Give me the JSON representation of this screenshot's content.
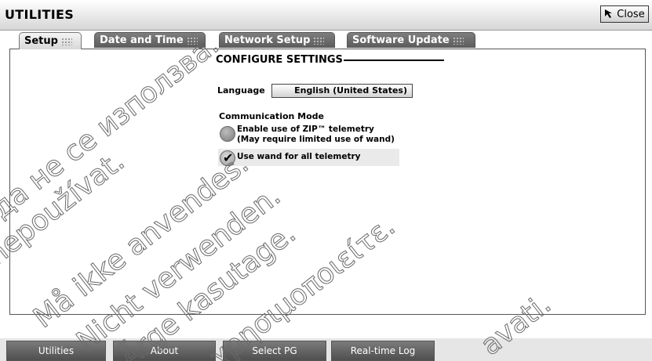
{
  "window": {
    "title": "UTILITIES",
    "close_label": "Close"
  },
  "tabs": [
    {
      "label": "Setup",
      "active": true
    },
    {
      "label": "Date and Time",
      "active": false
    },
    {
      "label": "Network Setup",
      "active": false
    },
    {
      "label": "Software Update",
      "active": false
    }
  ],
  "setup": {
    "heading": "CONFIGURE SETTINGS",
    "language_label": "Language",
    "language_value": "English (United States)",
    "comm_mode_label": "Communication Mode",
    "options": [
      {
        "line1": "Enable use of ZIP™ telemetry",
        "line2": "(May require limited use of wand)",
        "selected": false
      },
      {
        "line1": "Use wand for all telemetry",
        "selected": true
      }
    ]
  },
  "bottom_nav": [
    {
      "label": "Utilities"
    },
    {
      "label": "About"
    },
    {
      "label": "Select PG"
    },
    {
      "label": "Real-time Log"
    }
  ],
  "watermark": [
    "да не се използва.",
    "nepoužívat.",
    "Må ikke anvendes.",
    "Nicht verwenden.",
    "Ärge kasutage.",
    "χρησιμοποιείτε.",
    "avati."
  ]
}
